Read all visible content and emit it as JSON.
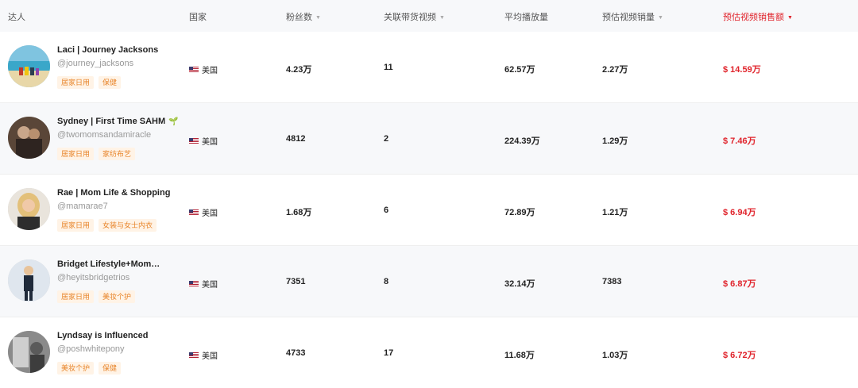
{
  "header": {
    "creator": "达人",
    "country": "国家",
    "followers": "粉丝数",
    "linked_videos": "关联带货视频",
    "avg_views": "平均播放量",
    "est_video_sales": "预估视频销量",
    "est_video_revenue": "预估视频销售额",
    "sort_caret": "▼",
    "sort_active_column": "est_video_revenue"
  },
  "colors": {
    "accent_red": "#e0232b",
    "tag_orange": "#e8852a",
    "tag_bg": "#fff3e6",
    "row_alt_bg": "#f7f8fa"
  },
  "rows": [
    {
      "name": "Laci | Journey Jacksons",
      "handle": "@journey_jacksons",
      "tags": [
        "居家日用",
        "保健"
      ],
      "flag_icon": "us-flag-icon",
      "country": "美国",
      "followers": "4.23万",
      "linked_videos": "11",
      "avg_views": "62.57万",
      "est_sales": "2.27万",
      "est_revenue": "$ 14.59万"
    },
    {
      "name": "Sydney | First Time SAHM",
      "name_emoji": "🌱",
      "handle": "@twomomsandamiracle",
      "tags": [
        "居家日用",
        "家纺布艺"
      ],
      "flag_icon": "us-flag-icon",
      "country": "美国",
      "followers": "4812",
      "linked_videos": "2",
      "avg_views": "224.39万",
      "est_sales": "1.29万",
      "est_revenue": "$ 7.46万"
    },
    {
      "name": "Rae | Mom Life & Shopping",
      "handle": "@mamarae7",
      "tags": [
        "居家日用",
        "女装与女士内衣"
      ],
      "flag_icon": "us-flag-icon",
      "country": "美国",
      "followers": "1.68万",
      "linked_videos": "6",
      "avg_views": "72.89万",
      "est_sales": "1.21万",
      "est_revenue": "$ 6.94万"
    },
    {
      "name": "Bridget Lifestyle+Mom…",
      "handle": "@heyitsbridgetrios",
      "tags": [
        "居家日用",
        "美妆个护"
      ],
      "flag_icon": "us-flag-icon",
      "country": "美国",
      "followers": "7351",
      "linked_videos": "8",
      "avg_views": "32.14万",
      "est_sales": "7383",
      "est_revenue": "$ 6.87万"
    },
    {
      "name": "Lyndsay is Influenced",
      "handle": "@poshwhitepony",
      "tags": [
        "美妆个护",
        "保健"
      ],
      "flag_icon": "us-flag-icon",
      "country": "美国",
      "followers": "4733",
      "linked_videos": "17",
      "avg_views": "11.68万",
      "est_sales": "1.03万",
      "est_revenue": "$ 6.72万"
    }
  ]
}
